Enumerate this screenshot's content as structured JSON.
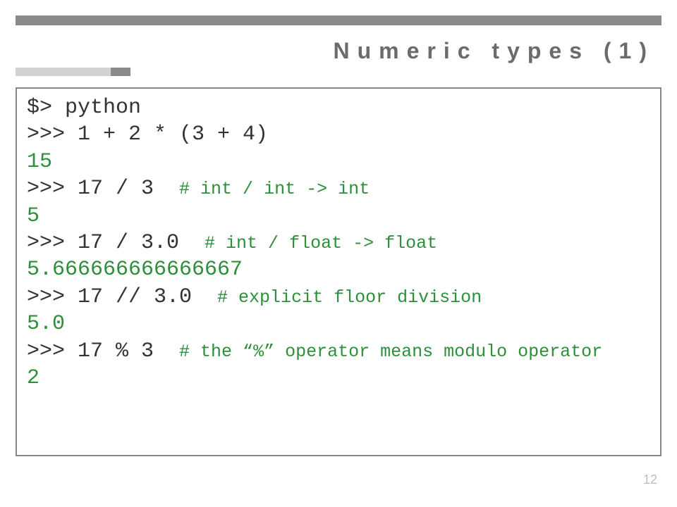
{
  "heading": "Numeric types (1)",
  "page_number": "12",
  "code": {
    "l1": {
      "cmd": "$> python"
    },
    "l2": {
      "cmd": ">>> 1 + 2 * (3 + 4)"
    },
    "l3": {
      "out": "15"
    },
    "l4": {
      "cmd": ">>> 17 / 3  ",
      "comment": "# int / int -> int"
    },
    "l5": {
      "out": "5"
    },
    "l6": {
      "cmd": ">>> 17 / 3.0  ",
      "comment": "# int / float -> float"
    },
    "l7": {
      "out": "5.666666666666667"
    },
    "l8": {
      "cmd": ">>> 17 // 3.0  ",
      "comment": "# explicit floor division"
    },
    "l9": {
      "out": "5.0"
    },
    "l10": {
      "cmd": ">>> 17 % 3  ",
      "comment": "# the “%” operator means modulo operator"
    },
    "l11": {
      "out": "2"
    }
  }
}
